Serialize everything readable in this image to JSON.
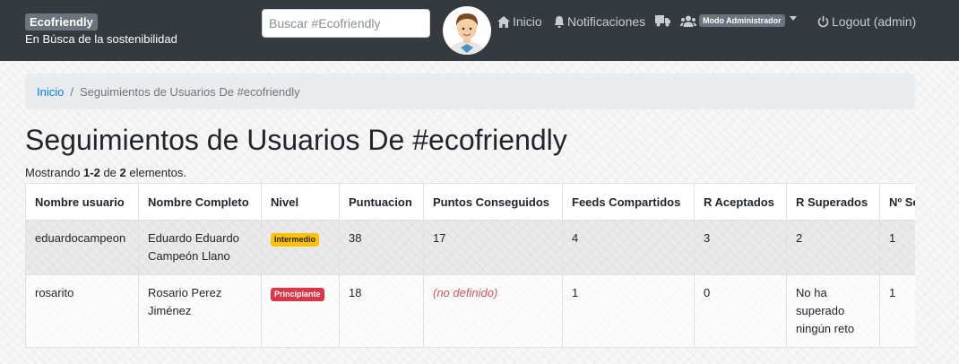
{
  "brand": {
    "name": "Ecofriendly",
    "tagline": "En Búsca de la sostenibilidad"
  },
  "search": {
    "placeholder": "Buscar #Ecofriendly"
  },
  "nav": {
    "home": "Inicio",
    "notifications": "Notificaciones",
    "admin_mode": "Modo Administrador",
    "logout": "Logout (admin)"
  },
  "icons": {
    "home": "home-icon",
    "bell": "bell-icon",
    "truck": "truck-icon",
    "users": "users-icon",
    "power": "power-icon"
  },
  "colors": {
    "navbar": "#343a40",
    "link": "#007bff",
    "warning": "#ffc107",
    "danger": "#dc3545",
    "notset": "#cc5555"
  },
  "breadcrumb": {
    "home": "Inicio",
    "current": "Seguimientos de Usuarios De #ecofriendly"
  },
  "page": {
    "title": "Seguimientos de Usuarios De #ecofriendly",
    "summary_prefix": "Mostrando ",
    "summary_range": "1-2",
    "summary_mid": " de ",
    "summary_total": "2",
    "summary_suffix": " elementos."
  },
  "table": {
    "headers": [
      "Nombre usuario",
      "Nombre Completo",
      "Nivel",
      "Puntuacion",
      "Puntos Conseguidos",
      "Feeds Compartidos",
      "R Aceptados",
      "R Superados",
      "Nº Se"
    ],
    "rows": [
      {
        "username": "eduardocampeon",
        "fullname": "Eduardo Eduardo Campeón Llano",
        "level": "Intermedio",
        "level_type": "warning",
        "score": "38",
        "points": "17",
        "feeds": "4",
        "accepted": "3",
        "surpassed": "2",
        "n": "1"
      },
      {
        "username": "rosarito",
        "fullname": "Rosario Perez Jiménez",
        "level": "Principiante",
        "level_type": "danger",
        "score": "18",
        "points": "(no definido)",
        "feeds": "1",
        "accepted": "0",
        "surpassed": "No ha superado ningún reto",
        "n": "1"
      }
    ]
  }
}
